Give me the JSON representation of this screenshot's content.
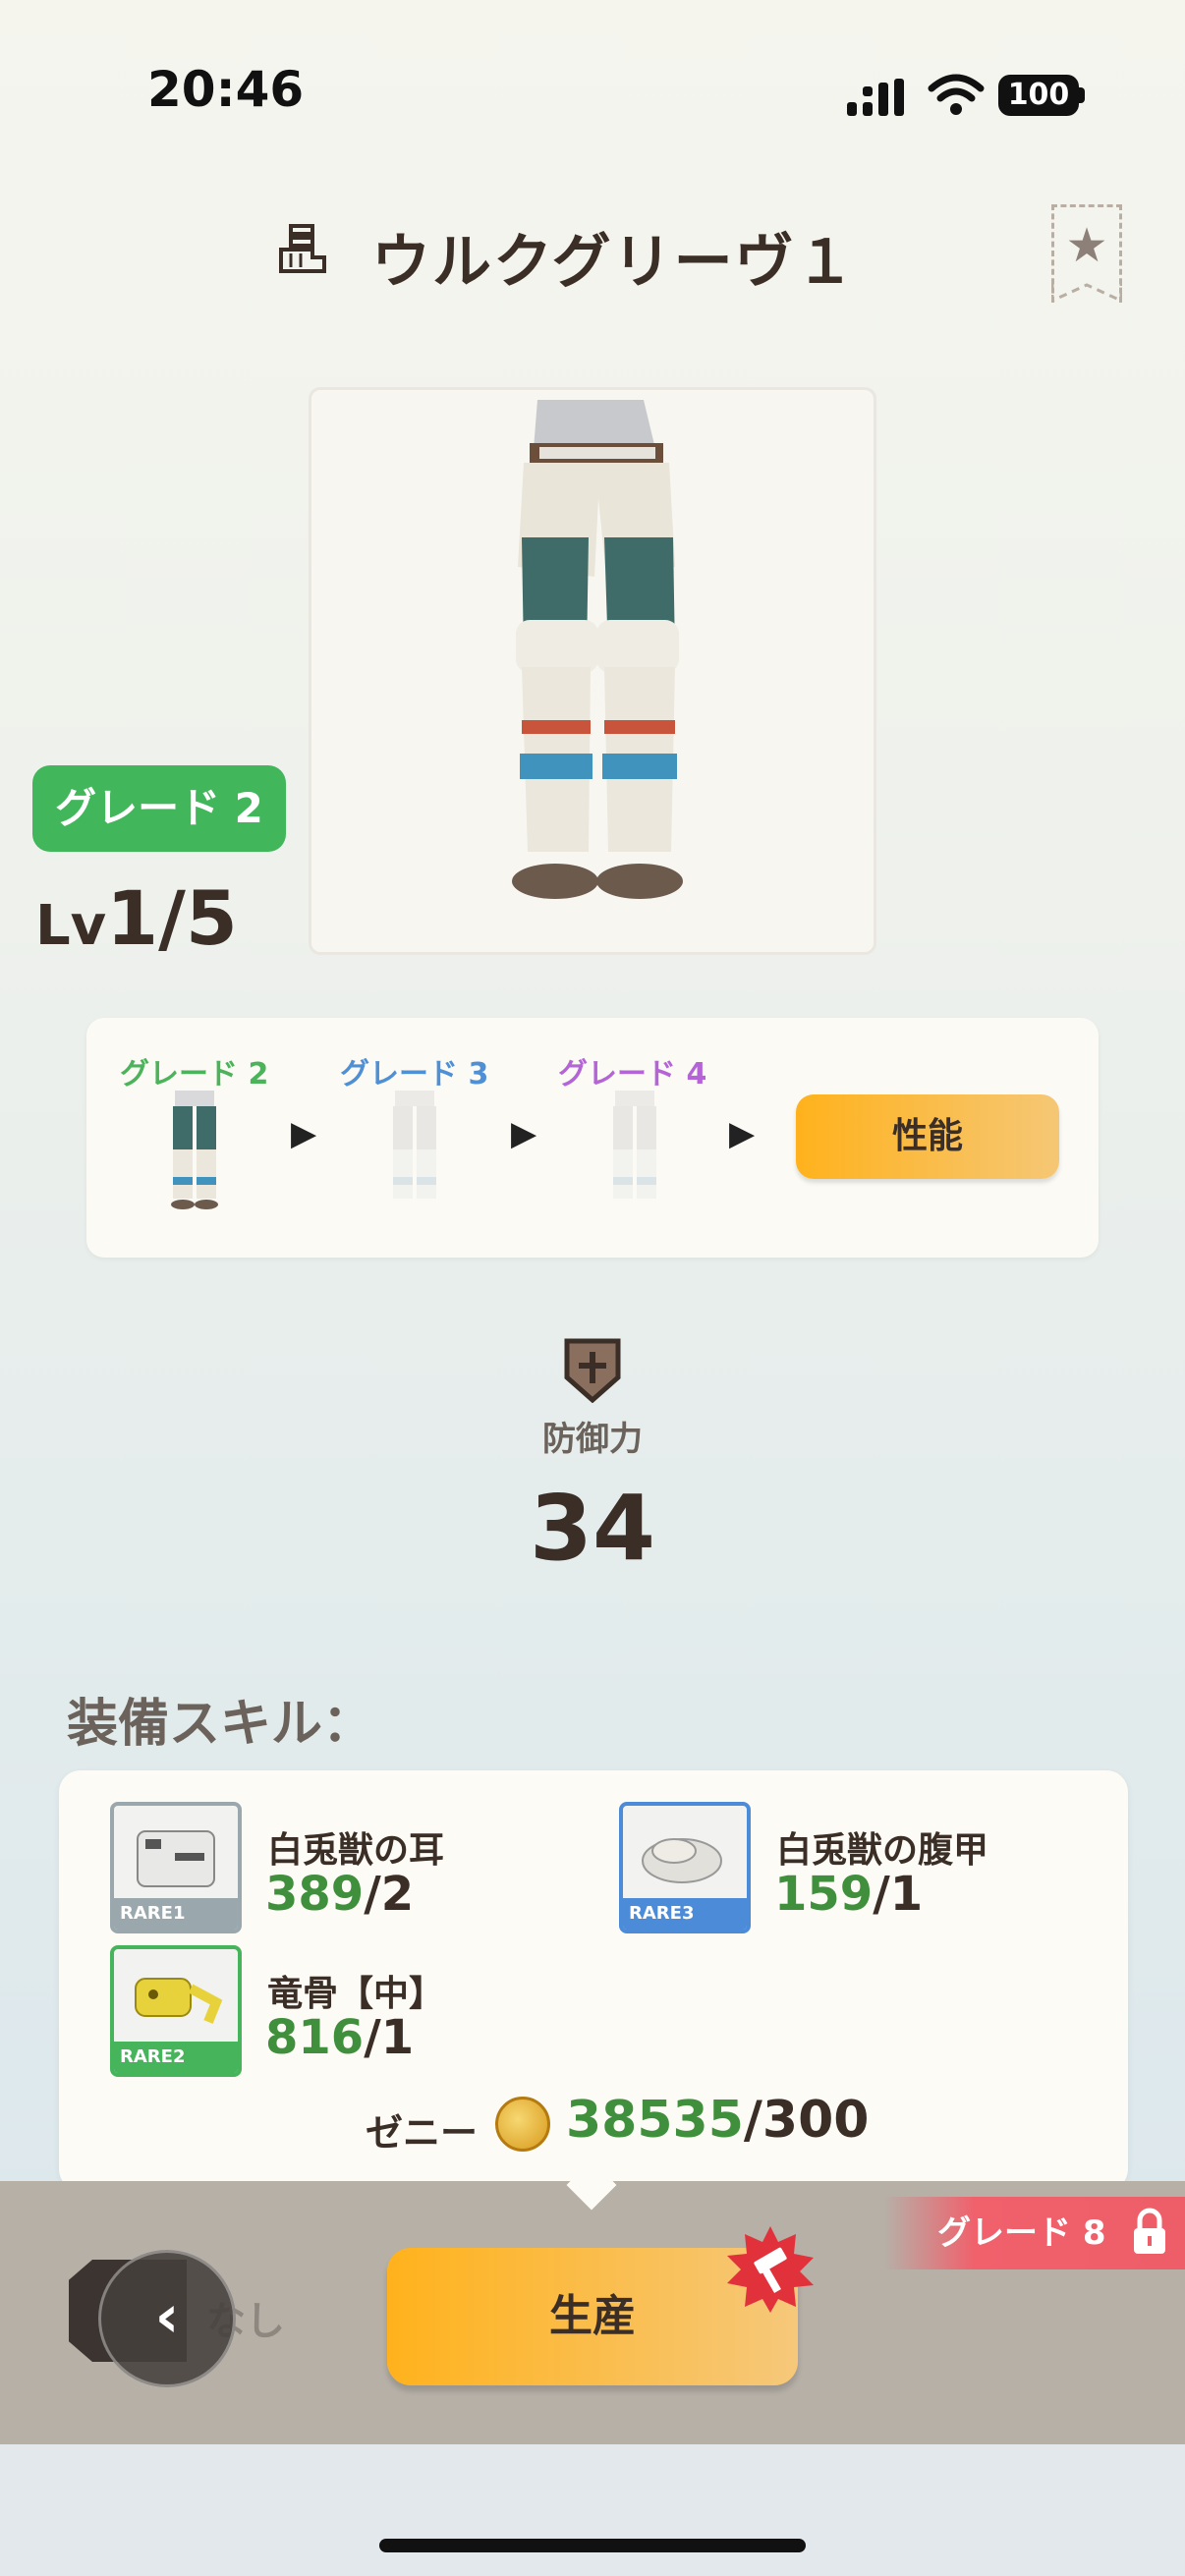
{
  "status": {
    "time": "20:46",
    "battery": "100"
  },
  "header": {
    "title": "ウルクグリーヴ１",
    "type_icon": "leg-armor-icon",
    "favorite_icon": "star-icon"
  },
  "item": {
    "grade_badge": "グレード 2",
    "lv_prefix": "Lv",
    "lv_value": "1/5"
  },
  "grade_track": {
    "grades": [
      {
        "label": "グレード 2",
        "color": "#4bb35a"
      },
      {
        "label": "グレード 3",
        "color": "#4f8fd6"
      },
      {
        "label": "グレード 4",
        "color": "#b564d8"
      }
    ],
    "performance_button": "性能"
  },
  "defense": {
    "label": "防御力",
    "value": "34",
    "icon": "shield-icon"
  },
  "skills": {
    "heading": "装備スキル："
  },
  "materials": [
    {
      "name": "白兎獣の耳",
      "have": "389",
      "need": "/2",
      "rarity": "RARE1",
      "border": "#9aa8ad"
    },
    {
      "name": "白兎獣の腹甲",
      "have": "159",
      "need": "/1",
      "rarity": "RARE3",
      "border": "#4b8bd8"
    },
    {
      "name": "竜骨【中】",
      "have": "816",
      "need": "/1",
      "rarity": "RARE2",
      "border": "#46b45a"
    }
  ],
  "zeny": {
    "label": "ゼニー",
    "have": "38535",
    "need": "/300",
    "icon": "coin-icon"
  },
  "bottom": {
    "grade_lock": "グレード 8",
    "none_label": "なし",
    "back_glyph": "‹",
    "produce_button": "生産"
  },
  "colors": {
    "accent": "#ffb21c",
    "have_green": "#3f8f3d",
    "grade_green": "#41b65a",
    "lock_red": "#ee5e68"
  }
}
